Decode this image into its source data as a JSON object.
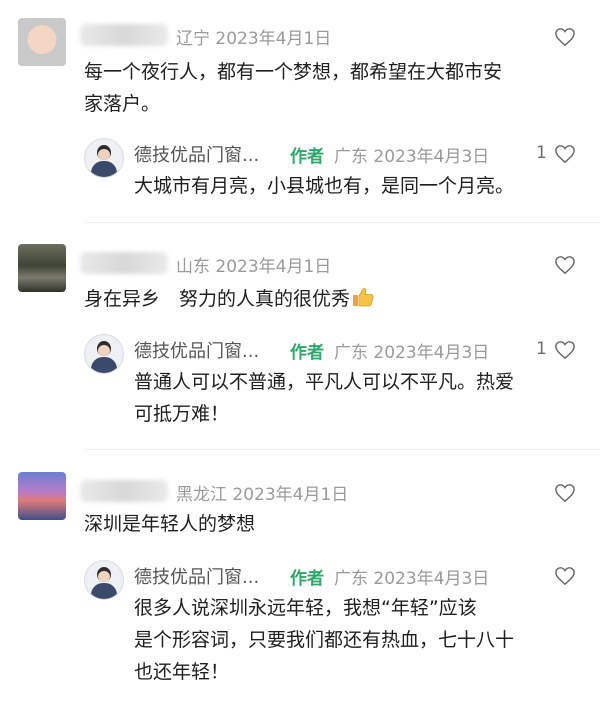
{
  "comments": [
    {
      "avatar_icon": "baby-avatar",
      "location": "辽宁",
      "date": "2023年4月1日",
      "text": [
        "每一个夜行人，都有一个梦想，都希望在大都市安",
        "家落户。"
      ],
      "reply": {
        "name": "德技优品门窗...",
        "author_tag": "作者",
        "location": "广东",
        "date": "2023年4月3日",
        "likes": "1",
        "text": [
          "大城市有月亮，小县城也有，是同一个月亮。"
        ]
      }
    },
    {
      "avatar_icon": "room-avatar",
      "location": "山东",
      "date": "2023年4月1日",
      "text": [
        "身在异乡　努力的人真的很优秀"
      ],
      "reply": {
        "name": "德技优品门窗...",
        "author_tag": "作者",
        "location": "广东",
        "date": "2023年4月3日",
        "likes": "1",
        "text": [
          "普通人可以不普通，平凡人可以不平凡。热爱",
          "可抵万难！"
        ]
      }
    },
    {
      "avatar_icon": "mountain-avatar",
      "location": "黑龙江",
      "date": "2023年4月1日",
      "text": [
        "深圳是年轻人的梦想"
      ],
      "reply": {
        "name": "德技优品门窗...",
        "author_tag": "作者",
        "location": "广东",
        "date": "2023年4月3日",
        "likes": "",
        "text": [
          "很多人说深圳永远年轻，我想“年轻”应该",
          "是个形容词，只要我们都还有热血，七十八十",
          "也还年轻！"
        ]
      }
    }
  ],
  "colors": {
    "meta": "#9a9a9a",
    "author_tag": "#2ea76a",
    "text": "#1f1f1f",
    "divider": "#eeeeee"
  },
  "icons": {
    "like": "heart-outline-icon",
    "emoji": "thumbs-up-emoji"
  }
}
